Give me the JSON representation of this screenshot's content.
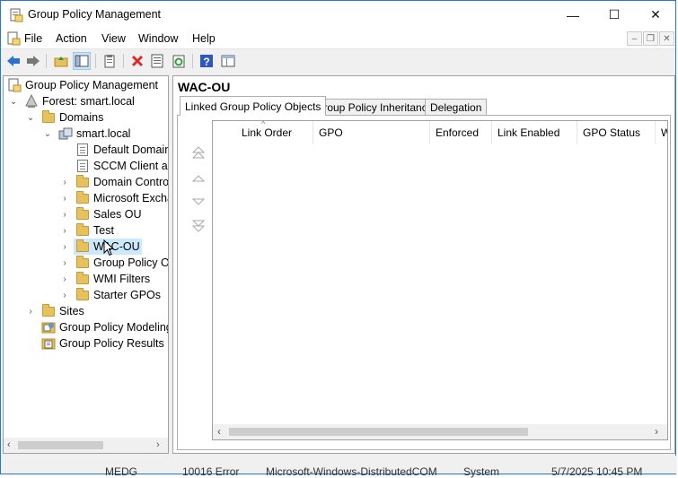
{
  "window": {
    "title": "Group Policy Management",
    "minimize_glyph": "—",
    "maximize_glyph": "☐",
    "close_glyph": "✕",
    "accent_color": "#1e7ad6"
  },
  "menubar": {
    "items": [
      "File",
      "Action",
      "View",
      "Window",
      "Help"
    ],
    "mdi_min": "–",
    "mdi_restore": "❐",
    "mdi_close": "✕"
  },
  "toolbar": {
    "buttons": [
      "back-icon",
      "forward-icon",
      "up-folder-icon",
      "show-hide-tree-icon",
      "properties-icon",
      "delete-icon",
      "export-list-icon",
      "refresh-icon",
      "help-icon",
      "details-view-icon"
    ]
  },
  "tree": {
    "root": "Group Policy Management",
    "forest": "Forest: smart.local",
    "domains": "Domains",
    "domain": "smart.local",
    "items": [
      "Default Domain",
      "SCCM Client an",
      "Domain Contro",
      "Microsoft Excha",
      "Sales OU",
      "Test",
      "WAC-OU",
      "Group Policy Ob",
      "WMI Filters",
      "Starter GPOs"
    ],
    "sites": "Sites",
    "modeling": "Group Policy Modeling",
    "results": "Group Policy Results",
    "selected": "WAC-OU"
  },
  "content": {
    "title": "WAC-OU",
    "tabs": [
      "Linked Group Policy Objects",
      "Group Policy Inheritance",
      "Delegation"
    ],
    "active_tab": "Linked Group Policy Objects",
    "columns": [
      "Link Order",
      "GPO",
      "Enforced",
      "Link Enabled",
      "GPO Status",
      "W"
    ]
  },
  "status_ghost": [
    "MEDG",
    "10016  Error",
    "Microsoft-Windows-DistributedCOM",
    "System",
    "5/7/2025 10:45 PM"
  ]
}
